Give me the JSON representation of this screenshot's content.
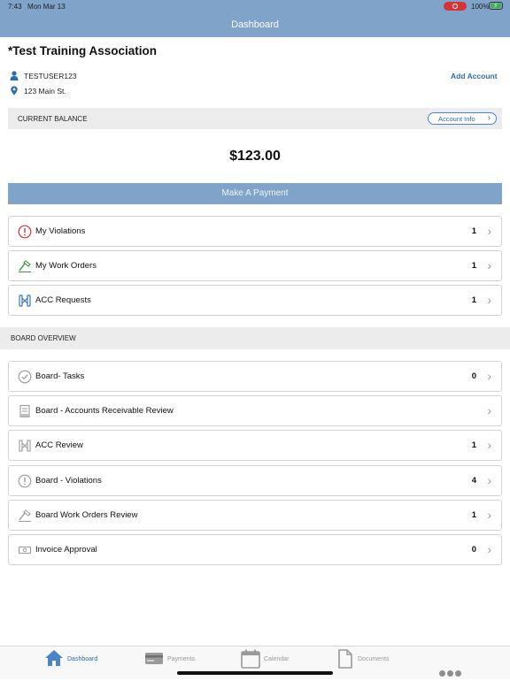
{
  "status": {
    "time": "7:43",
    "date": "Mon Mar 13",
    "battery": "100%"
  },
  "header": {
    "title": "Dashboard"
  },
  "association": {
    "name": "*Test Training Association",
    "user": "TESTUSER123",
    "address": "123 Main St.",
    "add_account": "Add Account"
  },
  "balance": {
    "label": "CURRENT BALANCE",
    "account_info": "Account Info",
    "amount": "$123.00",
    "pay_label": "Make A Payment"
  },
  "items": [
    {
      "label": "My Violations",
      "count": "1",
      "icon": "alert-circle-red-icon"
    },
    {
      "label": "My Work Orders",
      "count": "1",
      "icon": "hammer-icon"
    },
    {
      "label": "ACC Requests",
      "count": "1",
      "icon": "architecture-icon"
    }
  ],
  "board": {
    "label": "BOARD OVERVIEW",
    "items": [
      {
        "label": "Board- Tasks",
        "count": "0",
        "icon": "check-circle-icon"
      },
      {
        "label": "Board - Accounts Receivable Review",
        "count": "",
        "icon": "ledger-icon"
      },
      {
        "label": "ACC Review",
        "count": "1",
        "icon": "architecture-icon"
      },
      {
        "label": "Board - Violations",
        "count": "4",
        "icon": "alert-circle-icon"
      },
      {
        "label": "Board Work Orders Review",
        "count": "1",
        "icon": "hammer-icon"
      },
      {
        "label": "Invoice Approval",
        "count": "0",
        "icon": "money-icon"
      }
    ]
  },
  "nav": [
    {
      "label": "Dashboard",
      "icon": "home-icon",
      "active": true
    },
    {
      "label": "Payments",
      "icon": "credit-card-icon",
      "active": false
    },
    {
      "label": "Calendar",
      "icon": "calendar-icon",
      "active": false
    },
    {
      "label": "Documents",
      "icon": "document-icon",
      "active": false
    }
  ],
  "colors": {
    "header": "#7fa3c9",
    "link": "#2b6cb0",
    "alert": "#d63434",
    "muted": "#9a9a9a"
  }
}
